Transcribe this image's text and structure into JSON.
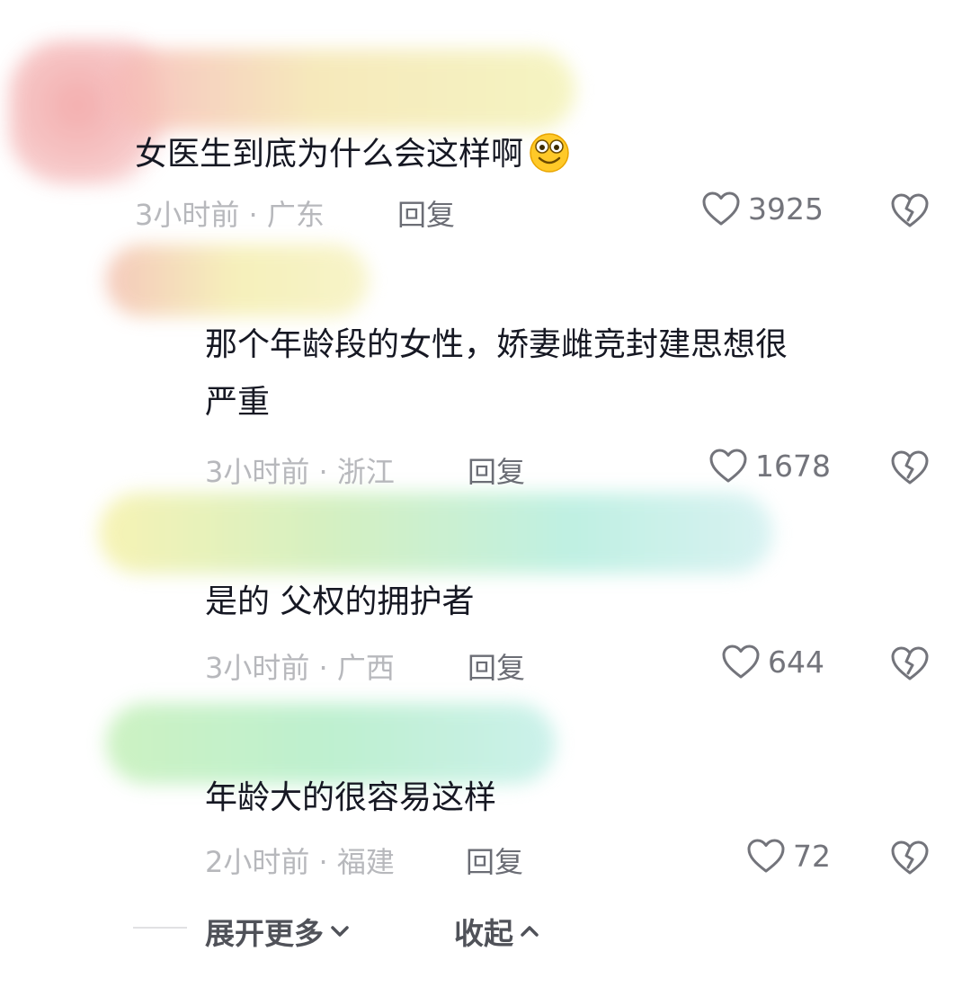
{
  "comments": [
    {
      "text": "女医生到底为什么会这样啊",
      "emoji": "smiling-face-emoji",
      "meta": "3小时前 · 广东",
      "reply": "回复",
      "likes": "3925"
    },
    {
      "text": "那个年龄段的女性，娇妻雌竞封建思想很\n严重",
      "meta": "3小时前 · 浙江",
      "reply": "回复",
      "likes": "1678"
    },
    {
      "text": "是的 父权的拥护者",
      "meta": "3小时前 · 广西",
      "reply": "回复",
      "likes": "644"
    },
    {
      "text": "年龄大的很容易这样",
      "meta": "2小时前 · 福建",
      "reply": "回复",
      "likes": "72"
    }
  ],
  "footer": {
    "expand": "展开更多",
    "collapse": "收起"
  },
  "colors": {
    "text": "#161823",
    "meta": "#b7b8bc",
    "icon": "#73747b"
  }
}
